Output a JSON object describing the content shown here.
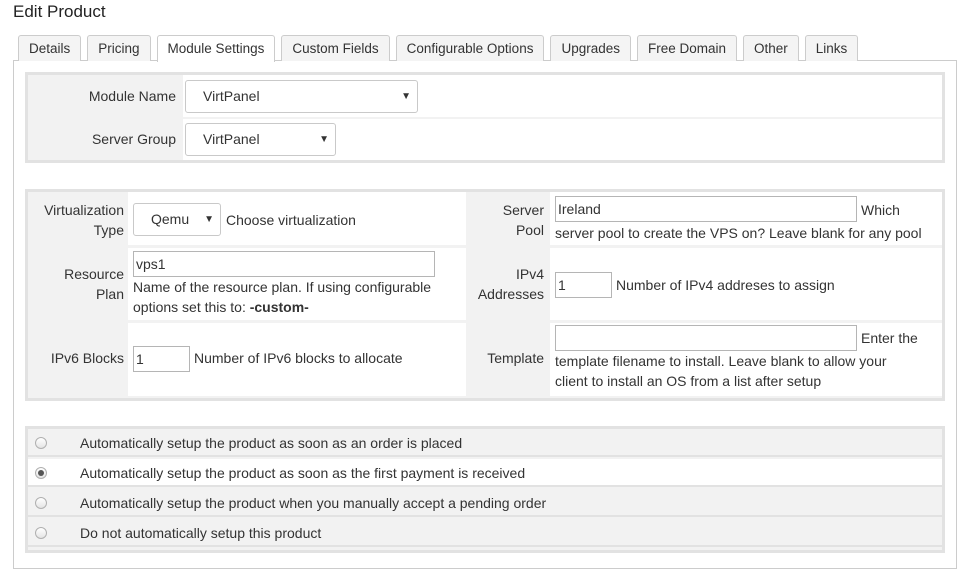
{
  "page": {
    "title": "Edit Product"
  },
  "tabs": [
    {
      "label": "Details"
    },
    {
      "label": "Pricing"
    },
    {
      "label": "Module Settings",
      "active": true
    },
    {
      "label": "Custom Fields"
    },
    {
      "label": "Configurable Options"
    },
    {
      "label": "Upgrades"
    },
    {
      "label": "Free Domain"
    },
    {
      "label": "Other"
    },
    {
      "label": "Links"
    }
  ],
  "module": {
    "module_name_label": "Module Name",
    "module_name_value": "VirtPanel",
    "server_group_label": "Server Group",
    "server_group_value": "VirtPanel"
  },
  "config": {
    "virt_label_1": "Virtualization",
    "virt_label_2": "Type",
    "virt_value": "Qemu",
    "virt_note": "Choose virtualization",
    "pool_label_1": "Server",
    "pool_label_2": "Pool",
    "pool_value": "Ireland",
    "pool_note_1": "Which",
    "pool_note_2": "server pool to create the VPS on? Leave blank for any pool",
    "plan_label_1": "Resource",
    "plan_label_2": "Plan",
    "plan_value": "vps1",
    "plan_note_1": "Name of the resource plan. If using configurable",
    "plan_note_2": "options set this to: ",
    "plan_note_bold": "-custom-",
    "ipv4_label_1": "IPv4",
    "ipv4_label_2": "Addresses",
    "ipv4_value": "1",
    "ipv4_note": "Number of IPv4 addreses to assign",
    "ipv6_label": "IPv6 Blocks",
    "ipv6_value": "1",
    "ipv6_note": "Number of IPv6 blocks to allocate",
    "template_label": "Template",
    "template_value": "",
    "template_note_1": "Enter the",
    "template_note_2": "template filename to install. Leave blank to allow your",
    "template_note_3": "client to install an OS from a list after setup"
  },
  "setup_options": [
    {
      "label": "Automatically setup the product as soon as an order is placed",
      "checked": false
    },
    {
      "label": "Automatically setup the product as soon as the first payment is received",
      "checked": true
    },
    {
      "label": "Automatically setup the product when you manually accept a pending order",
      "checked": false
    },
    {
      "label": "Do not automatically setup this product",
      "checked": false
    }
  ],
  "icons": {
    "select_arrow": "▼"
  }
}
